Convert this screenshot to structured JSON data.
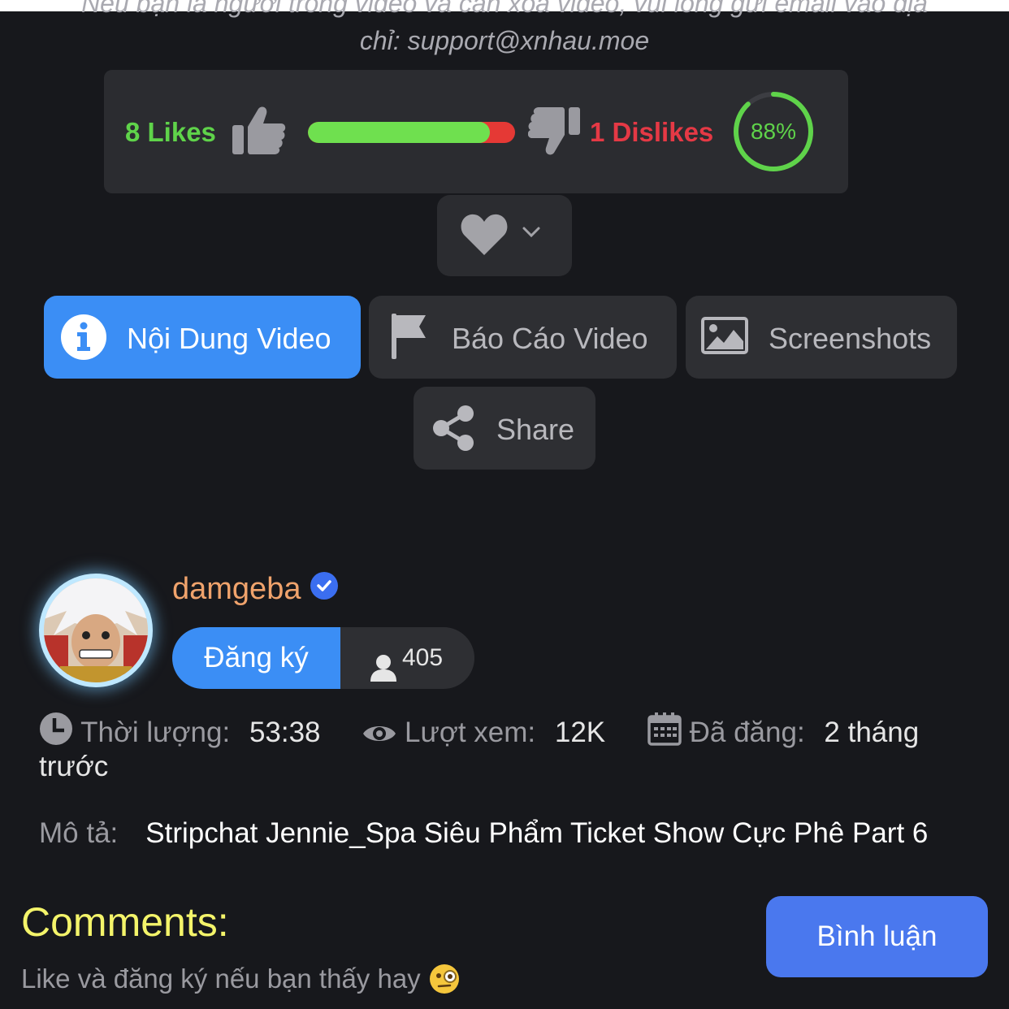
{
  "notice": {
    "cut_line": "Nếu bạn là người trong video và cần xóa video, vui lòng gửi email vào địa",
    "email_line": "chỉ: support@xnhau.moe"
  },
  "rating": {
    "likes_label": "8 Likes",
    "dislikes_label": "1 Dislikes",
    "percent_label": "88%",
    "like_ratio": 0.88,
    "like_color": "#5fd34a",
    "dislike_color": "#e53945"
  },
  "actions": {
    "favorite_icon": "heart-icon",
    "info_label": "Nội Dung Video",
    "report_label": "Báo Cáo Video",
    "screenshots_label": "Screenshots",
    "share_label": "Share",
    "accent": "#3b8ef5"
  },
  "channel": {
    "name": "damgeba",
    "subscribe_label": "Đăng ký",
    "subscriber_count": "405"
  },
  "meta": {
    "duration_key": "Thời lượng:",
    "duration_value": "53:38",
    "views_key": "Lượt xem:",
    "views_value": "12K",
    "posted_key": "Đã đăng:",
    "posted_value": "2 tháng trước"
  },
  "description": {
    "key": "Mô tả:",
    "value": "Stripchat Jennie_Spa Siêu Phẩm Ticket Show Cực Phê Part 6"
  },
  "comments": {
    "title": "Comments:",
    "button_label": "Bình luận",
    "hint": "Like và đăng ký nếu bạn thấy hay"
  }
}
